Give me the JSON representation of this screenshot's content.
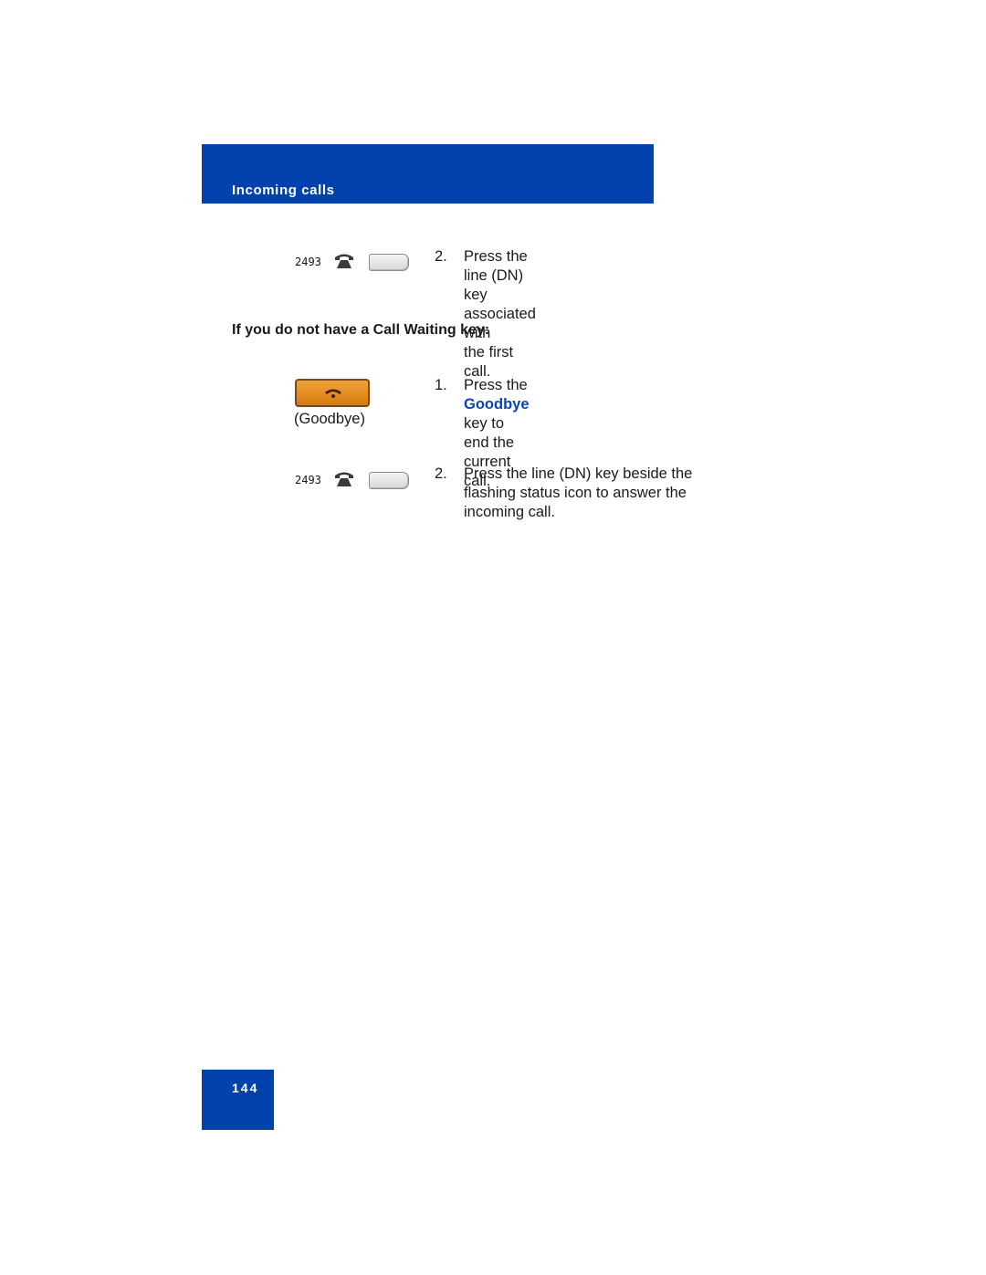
{
  "header": {
    "title": "Incoming calls"
  },
  "section1": {
    "line_key": {
      "dn": "2493",
      "icon": "phone-icon"
    },
    "step": {
      "number": "2.",
      "line1": "Press the line (DN) key associated with",
      "line2": "the first call."
    }
  },
  "section2": {
    "heading": "If you do not have a Call Waiting key:",
    "goodbye_key": {
      "icon": "hang-up-icon",
      "caption": "(Goodbye)"
    },
    "step1": {
      "number": "1.",
      "prefix": "Press the ",
      "highlight": "Goodbye",
      "suffix": " key to end the",
      "line2": "current call."
    },
    "line_key": {
      "dn": "2493",
      "icon": "phone-icon"
    },
    "step2": {
      "number": "2.",
      "line1": "Press the line (DN) key beside the",
      "line2": "flashing status icon to answer the",
      "line3": "incoming call."
    }
  },
  "footer": {
    "page_number": "144"
  },
  "colors": {
    "brand_blue": "#0041ad",
    "highlight_blue": "#0a45b5",
    "goodbye_orange": "#e08a20"
  }
}
